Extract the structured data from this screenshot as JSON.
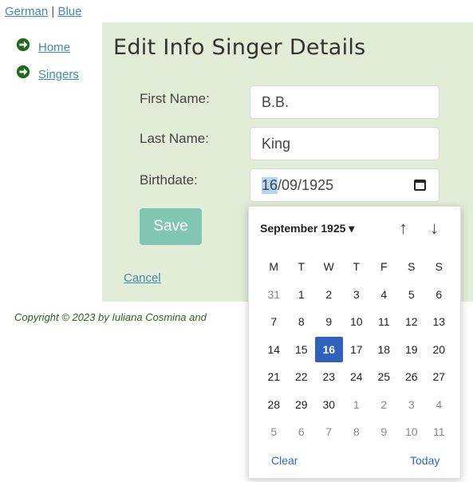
{
  "lang_bar": {
    "german": "German",
    "sep": "|",
    "blue": "Blue"
  },
  "nav": [
    {
      "label": "Home",
      "icon": "arrow-circle-right-icon"
    },
    {
      "label": "Singers",
      "icon": "arrow-circle-right-icon"
    }
  ],
  "colors": {
    "panel_bg": "#e1edd6",
    "accent": "#7fc7b0",
    "link": "#3d8fa6",
    "selected_day": "#2f62b8"
  },
  "page_title": "Edit Info Singer Details",
  "form": {
    "first_name_label": "First Name:",
    "first_name_value": "B.B.",
    "last_name_label": "Last Name:",
    "last_name_value": "King",
    "birthdate_label": "Birthdate:",
    "birthdate_day": "16",
    "birthdate_rest": "/09/1925",
    "save": "Save",
    "cancel": "Cancel"
  },
  "footer": "Copyright © 2023 by Iuliana Cosmina and",
  "datepicker": {
    "month_label": "September 1925 ▾",
    "up": "↑",
    "down": "↓",
    "weekdays": [
      "M",
      "T",
      "W",
      "T",
      "F",
      "S",
      "S"
    ],
    "weeks": [
      [
        {
          "d": "31",
          "m": true
        },
        {
          "d": "1"
        },
        {
          "d": "2"
        },
        {
          "d": "3"
        },
        {
          "d": "4"
        },
        {
          "d": "5"
        },
        {
          "d": "6"
        }
      ],
      [
        {
          "d": "7"
        },
        {
          "d": "8"
        },
        {
          "d": "9"
        },
        {
          "d": "10"
        },
        {
          "d": "11"
        },
        {
          "d": "12"
        },
        {
          "d": "13"
        }
      ],
      [
        {
          "d": "14"
        },
        {
          "d": "15"
        },
        {
          "d": "16",
          "sel": true
        },
        {
          "d": "17"
        },
        {
          "d": "18"
        },
        {
          "d": "19"
        },
        {
          "d": "20"
        }
      ],
      [
        {
          "d": "21"
        },
        {
          "d": "22"
        },
        {
          "d": "23"
        },
        {
          "d": "24"
        },
        {
          "d": "25"
        },
        {
          "d": "26"
        },
        {
          "d": "27"
        }
      ],
      [
        {
          "d": "28"
        },
        {
          "d": "29"
        },
        {
          "d": "30"
        },
        {
          "d": "1",
          "m": true
        },
        {
          "d": "2",
          "m": true
        },
        {
          "d": "3",
          "m": true
        },
        {
          "d": "4",
          "m": true
        }
      ],
      [
        {
          "d": "5",
          "m": true
        },
        {
          "d": "6",
          "m": true
        },
        {
          "d": "7",
          "m": true
        },
        {
          "d": "8",
          "m": true
        },
        {
          "d": "9",
          "m": true
        },
        {
          "d": "10",
          "m": true
        },
        {
          "d": "11",
          "m": true
        }
      ]
    ],
    "clear": "Clear",
    "today": "Today"
  }
}
